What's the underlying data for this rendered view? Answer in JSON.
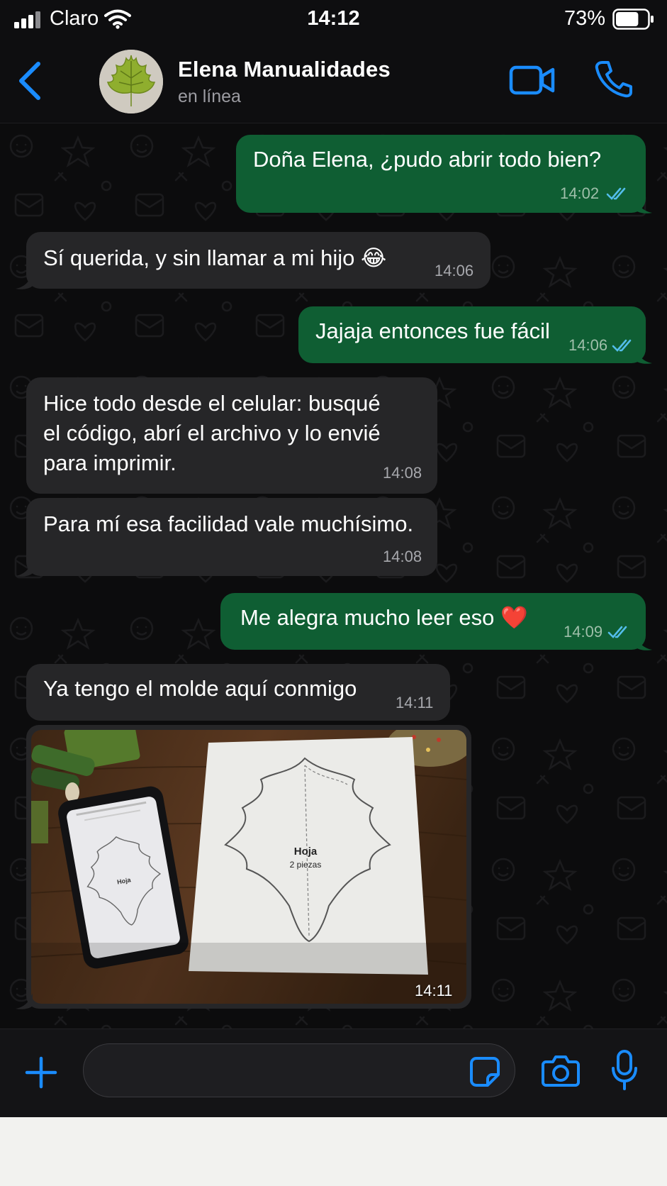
{
  "status_bar": {
    "carrier": "Claro",
    "time": "14:12",
    "battery_percent": "73%",
    "battery_level": 0.73
  },
  "header": {
    "contact_name": "Elena Manualidades",
    "contact_status": "en línea"
  },
  "messages": [
    {
      "direction": "out",
      "text": "Doña Elena, ¿pudo abrir todo bien?",
      "time": "14:02",
      "read": true
    },
    {
      "direction": "in",
      "text": "Sí querida, y sin llamar a mi hijo 😂",
      "time": "14:06"
    },
    {
      "direction": "out",
      "text": "Jajaja entonces fue fácil",
      "time": "14:06",
      "read": true
    },
    {
      "direction": "in",
      "lines": [
        "Hice todo desde el celular: busqué",
        "el código, abrí el archivo y lo envié",
        "para imprimir."
      ],
      "time": "14:08"
    },
    {
      "direction": "in",
      "text": "Para mí esa facilidad vale muchísimo.",
      "time": "14:08"
    },
    {
      "direction": "out",
      "text": "Me alegra mucho leer eso ❤️",
      "time": "14:09",
      "read": true
    },
    {
      "direction": "in",
      "text": "Ya tengo el molde aquí conmigo",
      "time": "14:11"
    }
  ],
  "photo_message": {
    "time": "14:11",
    "pattern_label": "Hoja",
    "pattern_sublabel": "2 piezas"
  },
  "colors": {
    "accent": "#1a8cff",
    "outgoing_bubble": "#0f5e33",
    "incoming_bubble": "#262628",
    "read_ticks": "#53bdeb"
  }
}
